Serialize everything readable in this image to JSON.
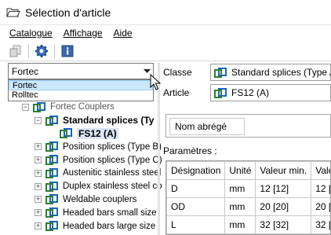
{
  "window": {
    "title": "Sélection d'article"
  },
  "menu": [
    {
      "label": "Catalogue"
    },
    {
      "label": "Affichage"
    },
    {
      "label": "Aide"
    }
  ],
  "catalog_combo": {
    "value": "Fortec",
    "options": [
      "Fortec",
      "Rolltec"
    ],
    "highlighted": "Fortec"
  },
  "tree": {
    "root": {
      "label": "Fortec Couplers"
    },
    "selected_group": {
      "label": "Standard splices (Ty"
    },
    "selected_item": {
      "label": "FS12 (A)"
    },
    "groups": [
      {
        "label": "Position splices (Type B)"
      },
      {
        "label": "Position splices (Type C)"
      },
      {
        "label": "Austenitic stainless steel"
      },
      {
        "label": "Duplex stainless steel co"
      },
      {
        "label": "Weldable couplers"
      },
      {
        "label": "Headed bars small size"
      },
      {
        "label": "Headed bars large size"
      }
    ]
  },
  "details": {
    "classe_label": "Classe",
    "classe_value": "Standard splices (Type A)",
    "article_label": "Article",
    "article_value": "FS12 (A)",
    "short_name_label": "Nom abrégé",
    "params_label": "Paramètres :"
  },
  "params": {
    "headers": [
      "Désignation",
      "Unité",
      "Valeur min.",
      "Vale"
    ],
    "rows": [
      [
        "D",
        "mm",
        "12 [12]",
        "12 ["
      ],
      [
        "OD",
        "mm",
        "20 [20]",
        "20 ["
      ],
      [
        "L",
        "mm",
        "32 [32]",
        "32 ["
      ]
    ]
  },
  "colors": {
    "accent": "#0b5ea8",
    "selection": "#cce8ff",
    "icon_blue": "#1565c0",
    "icon_green": "#2e7d32"
  }
}
